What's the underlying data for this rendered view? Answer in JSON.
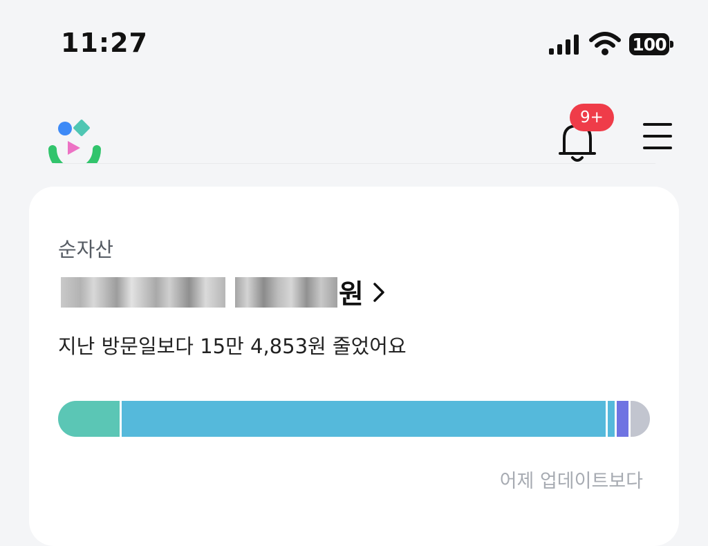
{
  "status_bar": {
    "time": "11:27",
    "battery_level": "100"
  },
  "header": {
    "notification_badge": "9+"
  },
  "card": {
    "net_label": "순자산",
    "amount_suffix": "원",
    "change_text": "지난 방문일보다 15만 4,853원 줄었어요",
    "update_note": "어제 업데이트보다"
  },
  "asset_bar": [
    {
      "color": "#5bc6b5",
      "fraction": 0.105
    },
    {
      "color": "#55b9db",
      "fraction": 0.83
    },
    {
      "color": "#55b9db",
      "fraction": 0.012
    },
    {
      "color": "#6f73e2",
      "fraction": 0.02
    },
    {
      "color": "#c2c5cf",
      "fraction": 0.033
    }
  ],
  "colors": {
    "background": "#f4f5f7",
    "badge": "#ef3c49",
    "text_secondary": "#555b63",
    "text_muted": "#a7abb2"
  }
}
